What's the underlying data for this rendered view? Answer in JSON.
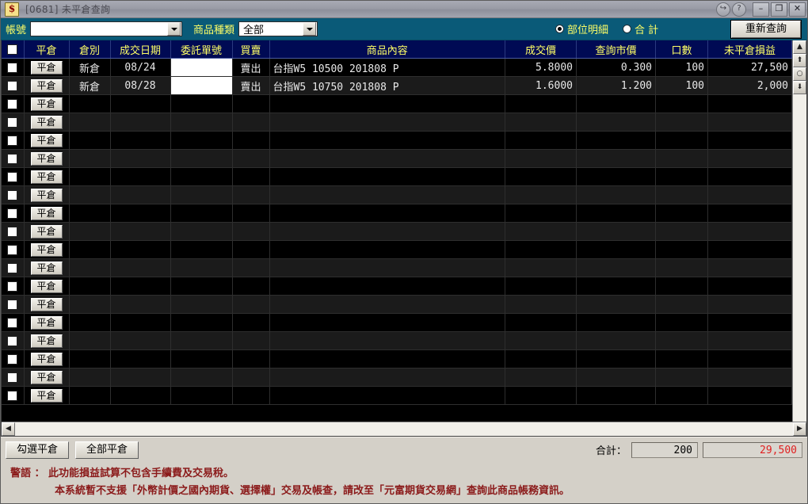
{
  "window": {
    "title": "[0681] 未平倉查詢",
    "app_icon": "dollar-icon",
    "buttons": {
      "exit": "↪",
      "help": "?",
      "minimize": "–",
      "restore": "❐",
      "close": "✕"
    }
  },
  "toolbar": {
    "account_label": "帳號",
    "account_value": "",
    "account_placeholder": "",
    "kind_label": "商品種類",
    "kind_value": "全部",
    "kind_options": [
      "全部"
    ],
    "radio_detail": "部位明細",
    "radio_total": "合  計",
    "radio_selected": "部位明細",
    "requery_label": "重新查詢"
  },
  "grid": {
    "columns": [
      {
        "key": "check",
        "label": ""
      },
      {
        "key": "close",
        "label": "平倉"
      },
      {
        "key": "warehouse",
        "label": "倉別"
      },
      {
        "key": "trade_date",
        "label": "成交日期"
      },
      {
        "key": "order_no",
        "label": "委託單號"
      },
      {
        "key": "side",
        "label": "買賣"
      },
      {
        "key": "product",
        "label": "商品內容"
      },
      {
        "key": "trade_price",
        "label": "成交價"
      },
      {
        "key": "market_price",
        "label": "查詢市價"
      },
      {
        "key": "lots",
        "label": "口數"
      },
      {
        "key": "pl",
        "label": "未平倉損益"
      }
    ],
    "close_button_label": "平倉",
    "rows": [
      {
        "close": "平倉",
        "warehouse": "新倉",
        "trade_date": "08/24",
        "order_no": "",
        "side": "賣出",
        "product": "台指W5 10500 201808 P",
        "trade_price": "5.8000",
        "market_price": "0.300",
        "lots": "100",
        "pl": "27,500"
      },
      {
        "close": "平倉",
        "warehouse": "新倉",
        "trade_date": "08/28",
        "order_no": "",
        "side": "賣出",
        "product": "台指W5 10750 201808 P",
        "trade_price": "1.6000",
        "market_price": "1.200",
        "lots": "100",
        "pl": "2,000"
      }
    ],
    "empty_row_count": 17
  },
  "footer": {
    "close_selected_label": "勾選平倉",
    "close_all_label": "全部平倉",
    "total_label": "合計：",
    "total_lots": "200",
    "total_pl": "29,500"
  },
  "warning": {
    "line1": "警語 ： 此功能損益試算不包含手續費及交易稅。",
    "line2": "本系統暫不支援「外幣計價之國內期貨、選擇權」交易及帳查，請改至「元富期貨交易網」查詢此商品帳務資訊。"
  },
  "colors": {
    "toolbar_bg": "#0a5a78",
    "header_bg": "#000a54",
    "header_text": "#ffff66",
    "profit_red": "#e02020",
    "sell_green": "#00c000",
    "warning_red": "#8b1a1a"
  },
  "scrollbars": {
    "v_up": "▲",
    "v_pageup": "⬆",
    "v_thumb": "○",
    "v_pagedown": "⬇",
    "h_left": "◀"
  }
}
